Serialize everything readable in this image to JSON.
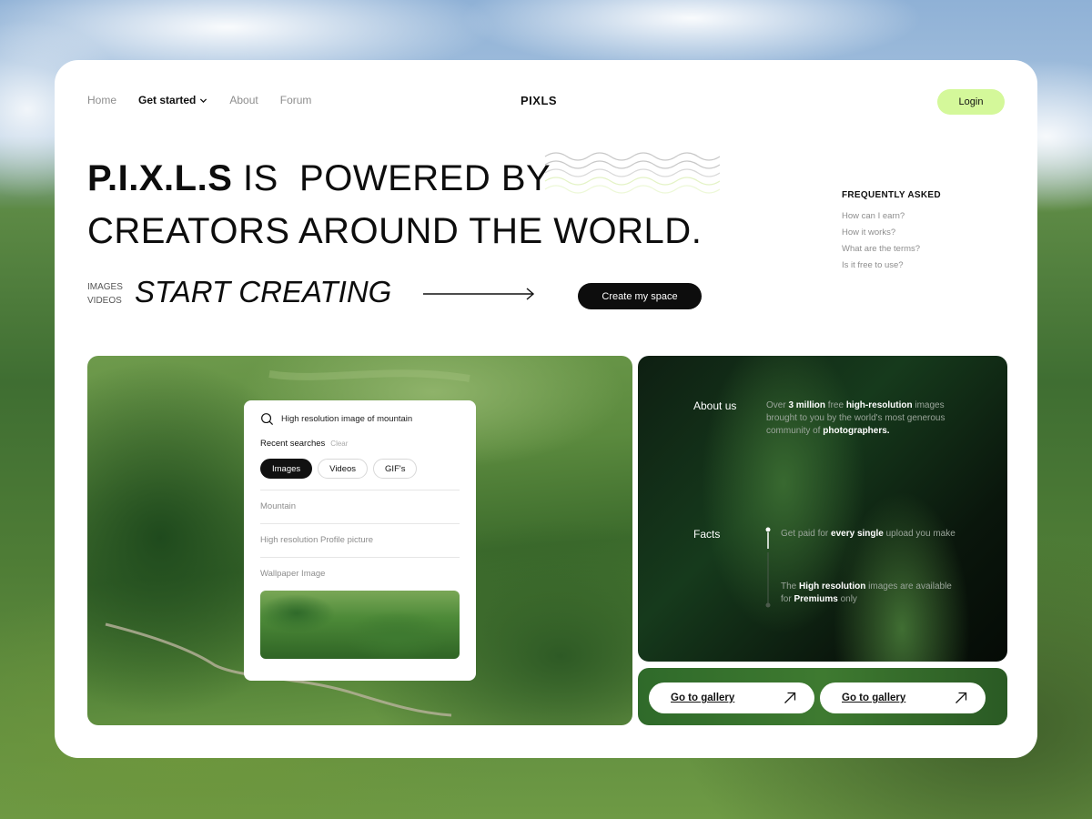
{
  "nav": {
    "home": "Home",
    "get_started": "Get started",
    "about": "About",
    "forum": "Forum",
    "brand": "PIXLS",
    "login": "Login"
  },
  "hero": {
    "line1_bold": "P.I.X.L.S",
    "line1_rest": " IS  POWERED BY",
    "line2": "CREATORS AROUND THE WORLD.",
    "media_label_1": "IMAGES",
    "media_label_2": "VIDEOS",
    "start_creating": "START CREATING",
    "create_button": "Create my space"
  },
  "faq": {
    "title": "FREQUENTLY ASKED",
    "items": [
      "How can I earn?",
      "How it works?",
      "What are the terms?",
      "Is it free to use?"
    ]
  },
  "search": {
    "query": "High resolution image of mountain",
    "recent_title": "Recent searches",
    "clear": "Clear",
    "chips": [
      "Images",
      "Videos",
      "GIF's"
    ],
    "active_chip": "Images",
    "results": [
      "Mountain",
      "High resolution Profile picture",
      "Wallpaper Image"
    ]
  },
  "info": {
    "about_label": "About us",
    "about_text": {
      "p1": "Over ",
      "b1": "3 million",
      "p2": " free ",
      "b2": "high-resolution",
      "p3": " images brought to you by the world's most generous community of ",
      "b3": "photographers."
    },
    "facts_label": "Facts",
    "fact1": {
      "p1": "Get paid for ",
      "b1": "every single",
      "p2": " upload you make"
    },
    "fact2": {
      "p1": "The ",
      "b1": "High resolution",
      "p2": " images are available for ",
      "b2": "Premiums",
      "p3": " only"
    }
  },
  "gallery": {
    "button_1": "Go to gallery",
    "button_2": "Go to gallery"
  },
  "colors": {
    "accent": "#d4f89a",
    "dark": "#0d0d0d"
  },
  "icons": {
    "chevron": "chevron-down-icon",
    "search": "search-icon",
    "arrow": "arrow-up-right-icon",
    "long_arrow": "arrow-right-icon"
  }
}
